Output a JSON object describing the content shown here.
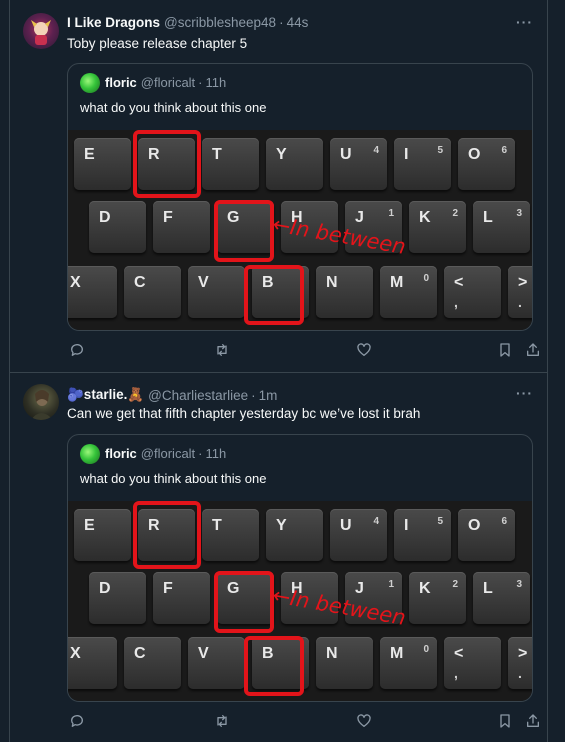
{
  "tweets": [
    {
      "name": "I Like Dragons",
      "handle": "@scribblesheep48",
      "separator": "·",
      "time": "44s",
      "text": "Toby please release chapter 5",
      "more_icon": "ellipsis-icon",
      "quote": {
        "name": "floric",
        "handle": "@floricalt",
        "separator": "·",
        "time": "11h",
        "text": "what do you think about this one"
      }
    },
    {
      "name": "🫐starlie.🧸",
      "handle": "@Charliestarliee",
      "separator": "·",
      "time": "1m",
      "text": "Can we get that fifth chapter yesterday bc we’ve lost it brah",
      "more_icon": "ellipsis-icon",
      "quote": {
        "name": "floric",
        "handle": "@floricalt",
        "separator": "·",
        "time": "11h",
        "text": "what do you think about this one"
      }
    }
  ],
  "keyboard": {
    "row1": [
      {
        "main": "E",
        "sub": ""
      },
      {
        "main": "R",
        "sub": ""
      },
      {
        "main": "T",
        "sub": ""
      },
      {
        "main": "Y",
        "sub": ""
      },
      {
        "main": "U",
        "sub": "4"
      },
      {
        "main": "I",
        "sub": "5"
      },
      {
        "main": "O",
        "sub": "6"
      }
    ],
    "row2": [
      {
        "main": "D",
        "sub": ""
      },
      {
        "main": "F",
        "sub": ""
      },
      {
        "main": "G",
        "sub": ""
      },
      {
        "main": "H",
        "sub": ""
      },
      {
        "main": "J",
        "sub": "1"
      },
      {
        "main": "K",
        "sub": "2"
      },
      {
        "main": "L",
        "sub": "3"
      }
    ],
    "row3": [
      {
        "main": "X",
        "sub": ""
      },
      {
        "main": "C",
        "sub": ""
      },
      {
        "main": "V",
        "sub": ""
      },
      {
        "main": "B",
        "sub": ""
      },
      {
        "main": "N",
        "sub": ""
      },
      {
        "main": "M",
        "sub": "0"
      },
      {
        "main": "<",
        "sub": "",
        "sub2": ","
      },
      {
        "main": ">",
        "sub": "",
        "sub2": "."
      }
    ],
    "annotation": "←In between",
    "highlight_color": "#e3141a"
  },
  "action_icons": [
    "reply-icon",
    "retweet-icon",
    "like-icon",
    "bookmark-icon",
    "share-icon"
  ],
  "colors": {
    "background": "#15202b",
    "border": "#38444d",
    "muted_text": "#8b98a5",
    "primary_text": "#f7f9f9"
  }
}
